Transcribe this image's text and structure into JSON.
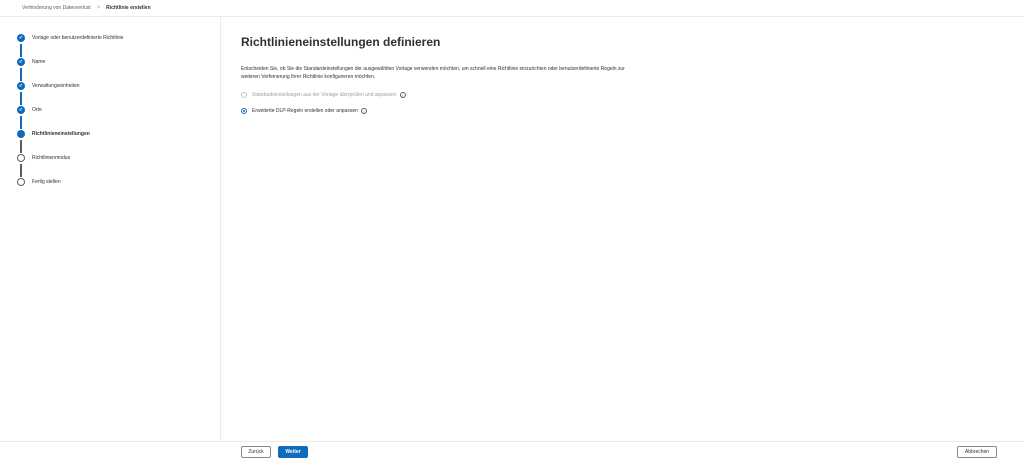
{
  "breadcrumb": {
    "parent": "Verhinderung von Datenverlust",
    "separator": ">",
    "current": "Richtlinie erstellen"
  },
  "steps": [
    {
      "label": "Vorlage oder benutzerdefinierte Richtlinie",
      "state": "done",
      "check": "✓"
    },
    {
      "label": "Name",
      "state": "done",
      "check": "✓"
    },
    {
      "label": "Verwaltungseinheiten",
      "state": "done",
      "check": "✓"
    },
    {
      "label": "Orte",
      "state": "done",
      "check": "✓"
    },
    {
      "label": "Richtlinieneinstellungen",
      "state": "current"
    },
    {
      "label": "Richtlinienmodus",
      "state": "todo"
    },
    {
      "label": "Fertig stellen",
      "state": "todo"
    }
  ],
  "main": {
    "title": "Richtlinieneinstellungen definieren",
    "description": "Entscheiden Sie, ob Sie die Standardeinstellungen der ausgewählten Vorlage verwenden möchten, um schnell eine Richtlinie einzurichten oder benutzerdefinierte Regeln zur weiteren Verfeinerung Ihrer Richtlinie konfigurieren möchten.",
    "options": [
      {
        "label": "Standardeinstellungen aus der Vorlage überprüfen und anpassen",
        "info": "i"
      },
      {
        "label": "Erweiterte DLP-Regeln erstellen oder anpassen",
        "info": "i"
      }
    ]
  },
  "footer": {
    "back_label": "Zurück",
    "next_label": "Weiter",
    "cancel_label": "Abbrechen"
  },
  "colors": {
    "accent": "#0f6cbd",
    "border": "#edebe9",
    "text": "#323130",
    "disabled_text": "#a19f9d"
  }
}
